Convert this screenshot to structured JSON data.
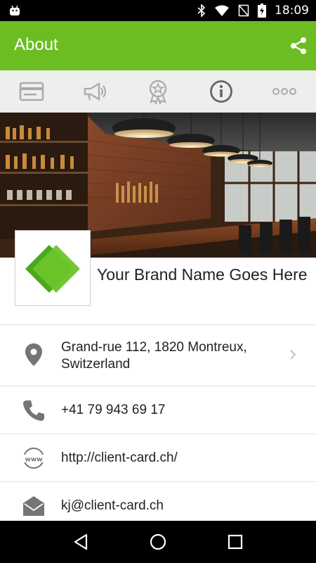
{
  "status_bar": {
    "time": "18:09",
    "icons": [
      "android-icon",
      "bluetooth-icon",
      "wifi-icon",
      "no-sim-icon",
      "battery-charging-icon"
    ]
  },
  "app_bar": {
    "title": "About",
    "action_icon": "share-icon",
    "color": "#6bbd22"
  },
  "tabs": [
    {
      "icon": "card-icon",
      "selected": false
    },
    {
      "icon": "megaphone-icon",
      "selected": false
    },
    {
      "icon": "award-icon",
      "selected": false
    },
    {
      "icon": "info-icon",
      "selected": true
    },
    {
      "icon": "more-icon",
      "selected": false
    }
  ],
  "hero": {
    "image": "bar-interior-photo"
  },
  "brand": {
    "name": "Your Brand Name Goes Here",
    "logo_color": "#5cb82a"
  },
  "contact": {
    "address": {
      "line1": "Grand-rue 112, 1820 Montreux,",
      "line2": "Switzerland",
      "icon": "location-pin-icon"
    },
    "phone": {
      "value": "+41 79 943 69 17",
      "icon": "phone-icon"
    },
    "website": {
      "value": "http://client-card.ch/",
      "icon": "www-icon"
    },
    "email": {
      "value": "kj@client-card.ch",
      "icon": "email-icon"
    }
  },
  "nav_bar": {
    "buttons": [
      "back-icon",
      "home-icon",
      "recents-icon"
    ]
  }
}
